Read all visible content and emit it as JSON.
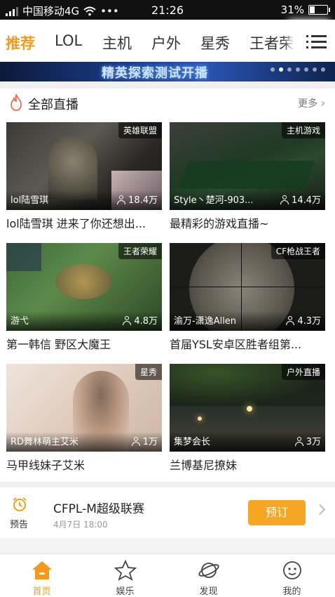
{
  "status_bar": {
    "carrier": "中国移动4G",
    "dots": "•••",
    "time": "21:26",
    "battery": "31%",
    "battery_level": 0.31
  },
  "tabs": [
    {
      "label": "推荐",
      "active": true
    },
    {
      "label": "LOL",
      "active": false
    },
    {
      "label": "主机",
      "active": false
    },
    {
      "label": "户外",
      "active": false
    },
    {
      "label": "星秀",
      "active": false
    },
    {
      "label": "王者荣",
      "active": false
    }
  ],
  "banner": {
    "text": "精英探索测试开播",
    "slide_count": 7,
    "active_slide": 2
  },
  "section": {
    "title": "全部直播",
    "more": "更多"
  },
  "cards": [
    {
      "category": "英雄联盟",
      "streamer": "lol陆雪琪",
      "viewers": "18.4万",
      "title": "lol陆雪琪 进来了你还想出..."
    },
    {
      "category": "主机游戏",
      "streamer": "Style丶楚河-903...",
      "viewers": "14.4万",
      "title": "最精彩的游戏直播~"
    },
    {
      "category": "王者荣耀",
      "streamer": "游弋",
      "viewers": "4.8万",
      "title": "第一韩信 野区大魔王"
    },
    {
      "category": "CF枪战王者",
      "streamer": "渝万-潇逸Allen",
      "viewers": "4.3万",
      "title": "首届YSL安卓区胜者组第..."
    },
    {
      "category": "星秀",
      "streamer": "RD舞林萌主艾米",
      "viewers": "1万",
      "title": "马甲线妹子艾米"
    },
    {
      "category": "户外直播",
      "streamer": "集梦会长",
      "viewers": "3万",
      "title": "兰博基尼撩妹"
    }
  ],
  "event": {
    "badge": "预告",
    "title": "CFPL-M超级联赛",
    "time": "4月7日 18:00",
    "button": "预订"
  },
  "bottom_nav": [
    {
      "label": "首页",
      "icon": "home-icon",
      "active": true
    },
    {
      "label": "娱乐",
      "icon": "star-icon",
      "active": false
    },
    {
      "label": "发现",
      "icon": "planet-icon",
      "active": false
    },
    {
      "label": "我的",
      "icon": "profile-icon",
      "active": false
    }
  ],
  "colors": {
    "accent": "#f39a1e",
    "button": "#f5a623"
  }
}
